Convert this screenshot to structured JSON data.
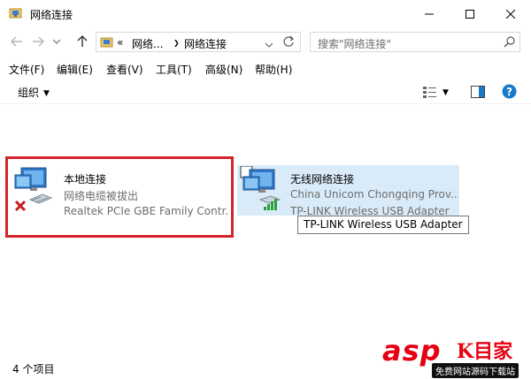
{
  "window": {
    "title": "网络连接"
  },
  "nav": {
    "breadcrumb_prefix": "«",
    "breadcrumb_parent": "网络...",
    "breadcrumb_current": "网络连接",
    "search_placeholder": "搜索\"网络连接\""
  },
  "menu": [
    "文件(F)",
    "编辑(E)",
    "查看(V)",
    "工具(T)",
    "高级(N)",
    "帮助(H)"
  ],
  "toolbar": {
    "organize_label": "组织"
  },
  "adapters": [
    {
      "name": "本地连接",
      "status": "网络电缆被拔出",
      "device": "Realtek PCIe GBE Family Contr...",
      "state": "disconnected"
    },
    {
      "name": "无线网络连接",
      "status": "China Unicom Chongqing Prov...",
      "device": "TP-LINK Wireless USB Adapter",
      "state": "connected"
    }
  ],
  "tooltip": "TP-LINK Wireless USB Adapter",
  "status_bar": "4 个项目",
  "watermark": {
    "brand": "asp",
    "brand_cn": "K目家",
    "sub": "免费网站源码下载站"
  },
  "colors": {
    "highlight_box": "#d4232a",
    "selection": "#d9ebf9",
    "help_icon": "#1979ca"
  }
}
